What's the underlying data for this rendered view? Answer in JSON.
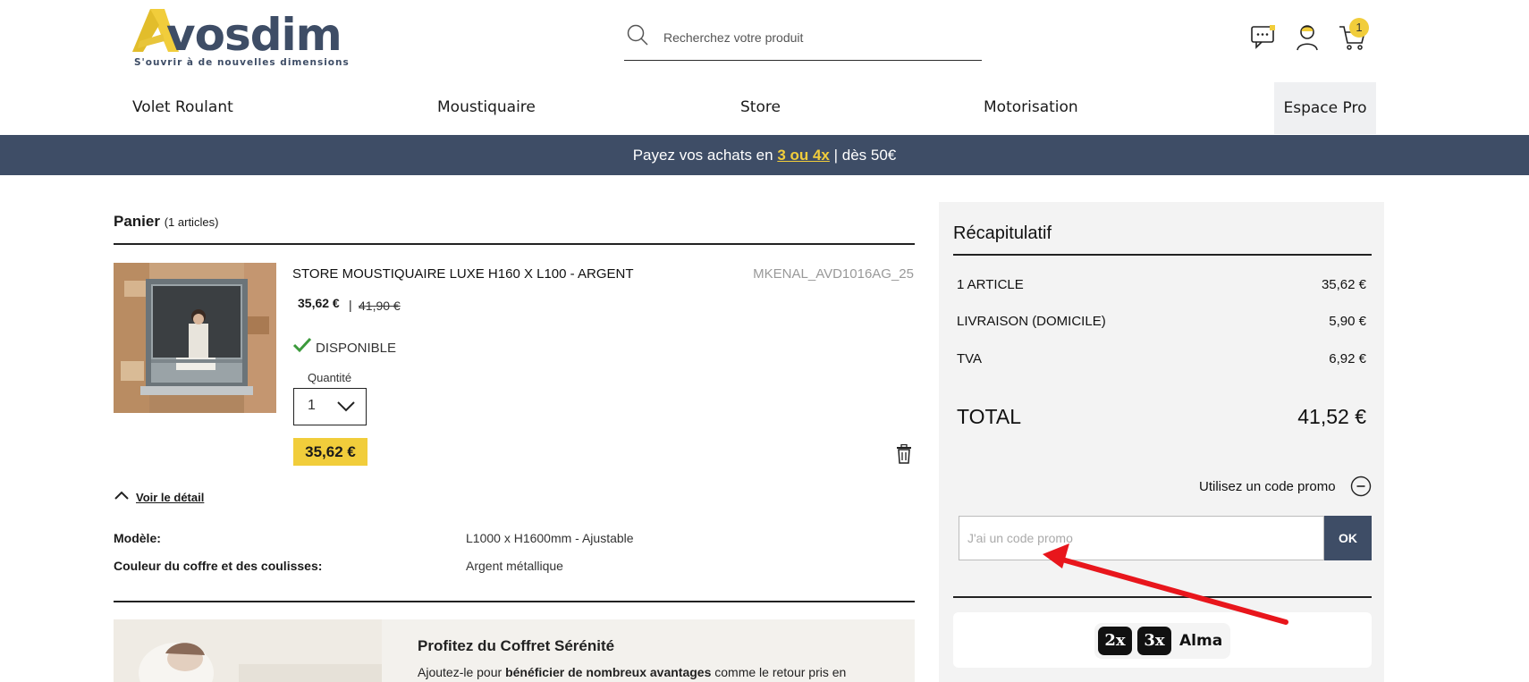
{
  "header": {
    "logo_text": "vosdim",
    "logo_tagline": "S'ouvrir à de nouvelles dimensions",
    "search_placeholder": "Recherchez votre produit",
    "cart_count": "1"
  },
  "nav": {
    "items": [
      "Volet Roulant",
      "Moustiquaire",
      "Store",
      "Motorisation"
    ],
    "pro_label": "Espace Pro"
  },
  "banner": {
    "prefix": "Payez vos achats en ",
    "highlight": "3 ou 4x",
    "suffix": " | dès 50€"
  },
  "cart": {
    "title": "Panier",
    "count_label": "(1 articles)",
    "product": {
      "name": "STORE MOUSTIQUAIRE LUXE H160 X L100 - ARGENT",
      "reference": "MKENAL_AVD1016AG_25",
      "price": "35,62 €",
      "price_separator": "|",
      "old_price": "41,90 €",
      "availability": "DISPONIBLE",
      "quantity_label": "Quantité",
      "quantity_value": "1",
      "line_total": "35,62 €"
    },
    "detail_link": "Voir le détail",
    "specs": [
      {
        "label": "Modèle:",
        "value": "L1000 x H1600mm - Ajustable"
      },
      {
        "label": "Couleur du coffre et des coulisses:",
        "value": "Argent métallique"
      }
    ],
    "promo": {
      "title": "Profitez du Coffret Sérénité",
      "text_prefix": "Ajoutez-le pour ",
      "text_bold": "bénéficier de nombreux avantages",
      "text_suffix": " comme le retour pris en"
    }
  },
  "summary": {
    "title": "Récapitulatif",
    "rows": [
      {
        "label": "1 ARTICLE",
        "value": "35,62 €"
      },
      {
        "label": "LIVRAISON (DOMICILE)",
        "value": "5,90 €"
      },
      {
        "label": "TVA",
        "value": "6,92 €"
      }
    ],
    "total_label": "TOTAL",
    "total_value": "41,52 €",
    "promo_link": "Utilisez un code promo",
    "promo_placeholder": "J'ai un code promo",
    "promo_button": "OK",
    "alma": {
      "option_1": "2x",
      "option_2": "3x",
      "brand": "Alma"
    }
  },
  "colors": {
    "brand_navy": "#3e4d66",
    "brand_yellow": "#f1cd3b",
    "annotation_red": "#e8161c"
  }
}
